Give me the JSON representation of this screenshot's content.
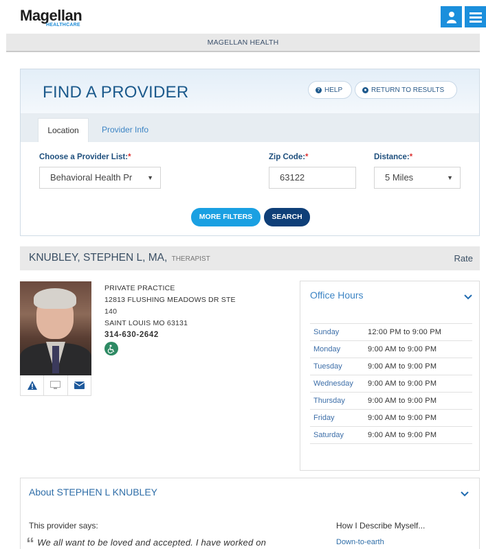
{
  "header": {
    "logo_main": "Magellan",
    "logo_sub": "HEALTHCARE",
    "subtitle": "MAGELLAN HEALTH"
  },
  "find": {
    "title": "FIND A PROVIDER",
    "help_label": "HELP",
    "return_label": "RETURN TO RESULTS",
    "tabs": [
      {
        "label": "Location",
        "active": true
      },
      {
        "label": "Provider Info",
        "active": false
      }
    ],
    "provider_list": {
      "label": "Choose a Provider List:",
      "value": "Behavioral Health Pr"
    },
    "zip": {
      "label": "Zip Code:",
      "value": "63122"
    },
    "distance": {
      "label": "Distance:",
      "value": "5 Miles"
    },
    "required_mark": "*",
    "more_filters_label": "MORE FILTERS",
    "search_label": "SEARCH"
  },
  "provider": {
    "name": "KNUBLEY, STEPHEN L, MA,",
    "title": "THERAPIST",
    "rate_label": "Rate",
    "address": {
      "line1": "PRIVATE PRACTICE",
      "line2": "12813 FLUSHING MEADOWS DR STE",
      "line3": "140",
      "line4": "SAINT LOUIS MO 63131",
      "phone": "314-630-2642"
    },
    "icons": [
      "warning-icon",
      "monitor-icon",
      "envelope-icon",
      "wheelchair-icon"
    ]
  },
  "office_hours": {
    "title": "Office Hours",
    "rows": [
      {
        "day": "Sunday",
        "time": "12:00 PM to 9:00 PM"
      },
      {
        "day": "Monday",
        "time": "9:00 AM to 9:00 PM"
      },
      {
        "day": "Tuesday",
        "time": "9:00 AM to 9:00 PM"
      },
      {
        "day": "Wednesday",
        "time": "9:00 AM to 9:00 PM"
      },
      {
        "day": "Thursday",
        "time": "9:00 AM to 9:00 PM"
      },
      {
        "day": "Friday",
        "time": "9:00 AM to 9:00 PM"
      },
      {
        "day": "Saturday",
        "time": "9:00 AM to 9:00 PM"
      }
    ]
  },
  "about": {
    "title": "About STEPHEN L KNUBLEY",
    "says_label": "This provider says:",
    "quote": "We all want to be loved and accepted. I have worked on",
    "describe_label": "How I Describe Myself...",
    "describe_item": "Down-to-earth"
  },
  "colors": {
    "brand_blue": "#1b8fdc",
    "navy": "#0f3f78",
    "link": "#3c84c4"
  }
}
